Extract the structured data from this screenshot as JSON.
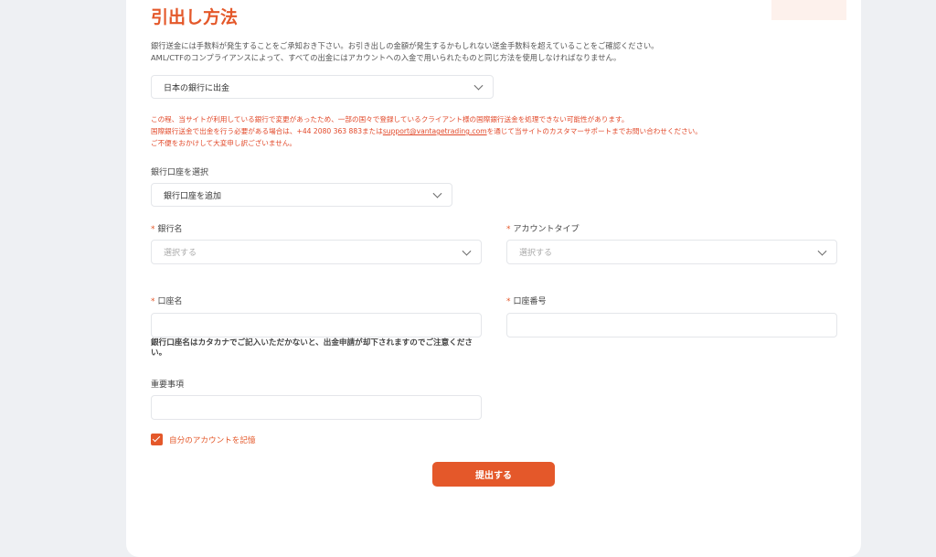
{
  "page_title": "引出し方法",
  "intro": {
    "line1": "銀行送金には手数料が発生することをご承知おき下さい。お引き出しの金額が発生するかもしれない送金手数料を超えていることをご確認ください。",
    "line2": "AML/CTFのコンプライアンスによって、すべての出金にはアカウントへの入金で用いられたものと同じ方法を使用しなければなりません。"
  },
  "withdraw_method": {
    "selected": "日本の銀行に出金"
  },
  "warning": {
    "line1": "この程、当サイトが利用している銀行で変更があったため、一部の国々で登録しているクライアント様の国際銀行送金を処理できない可能性があります。",
    "line2_before": "国際銀行送金で出金を行う必要がある場合は、+44 2080 363 883または",
    "line2_email": "support@vantagetrading.com",
    "line2_after": "を通じて当サイトのカスタマーサポートまでお問い合わせください。",
    "line3": "ご不便をおかけして大変申し訳ございません。"
  },
  "bank_account": {
    "label": "銀行口座を選択",
    "selected": "銀行口座を追加"
  },
  "bank_name": {
    "required_mark": "*",
    "label": "銀行名",
    "placeholder": "選択する"
  },
  "account_type": {
    "required_mark": "*",
    "label": "アカウントタイプ",
    "placeholder": "選択する"
  },
  "account_name": {
    "required_mark": "*",
    "label": "口座名",
    "value": "",
    "note": "銀行口座名はカタカナでご記入いただかないと、出金申請が却下されますのでご注意ください。"
  },
  "account_number": {
    "required_mark": "*",
    "label": "口座番号",
    "value": ""
  },
  "important_notes": {
    "label": "重要事項",
    "value": ""
  },
  "remember_account": {
    "label": "自分のアカウントを記憶",
    "checked": true
  },
  "submit_label": "提出する",
  "colors": {
    "accent": "#e4582a",
    "warning_text": "#e2492a",
    "background": "#eef0f3"
  }
}
